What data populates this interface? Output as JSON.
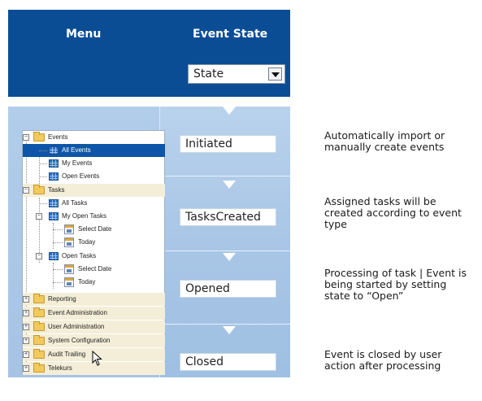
{
  "header": {
    "menu_label": "Menu",
    "event_state_label": "Event State",
    "state_dropdown_value": "State"
  },
  "states": [
    {
      "label": "Initiated",
      "description": "Automatically import or manually create events"
    },
    {
      "label": "TasksCreated",
      "description": "Assigned tasks will be created according to event type"
    },
    {
      "label": "Opened",
      "description": "Processing of task | Event is being started by setting state to “Open”"
    },
    {
      "label": "Closed",
      "description": "Event is closed by user action after processing"
    }
  ],
  "tree": {
    "events": "Events",
    "all_events": "All Events",
    "my_events": "My Events",
    "open_events": "Open Events",
    "tasks": "Tasks",
    "all_tasks": "All Tasks",
    "my_open_tasks": "My Open Tasks",
    "select_date_1": "Select Date",
    "today_1": "Today",
    "open_tasks": "Open Tasks",
    "select_date_2": "Select Date",
    "today_2": "Today",
    "reporting": "Reporting",
    "event_administration": "Event Administration",
    "user_administration": "User Administration",
    "system_configuration": "System Configuration",
    "audit_trailing": "Audit Trailing",
    "telekurs": "Telekurs"
  },
  "colors": {
    "header_blue": "#0b4d95",
    "light_blue": "#a9c6e6",
    "selection_blue": "#0d55a8"
  }
}
